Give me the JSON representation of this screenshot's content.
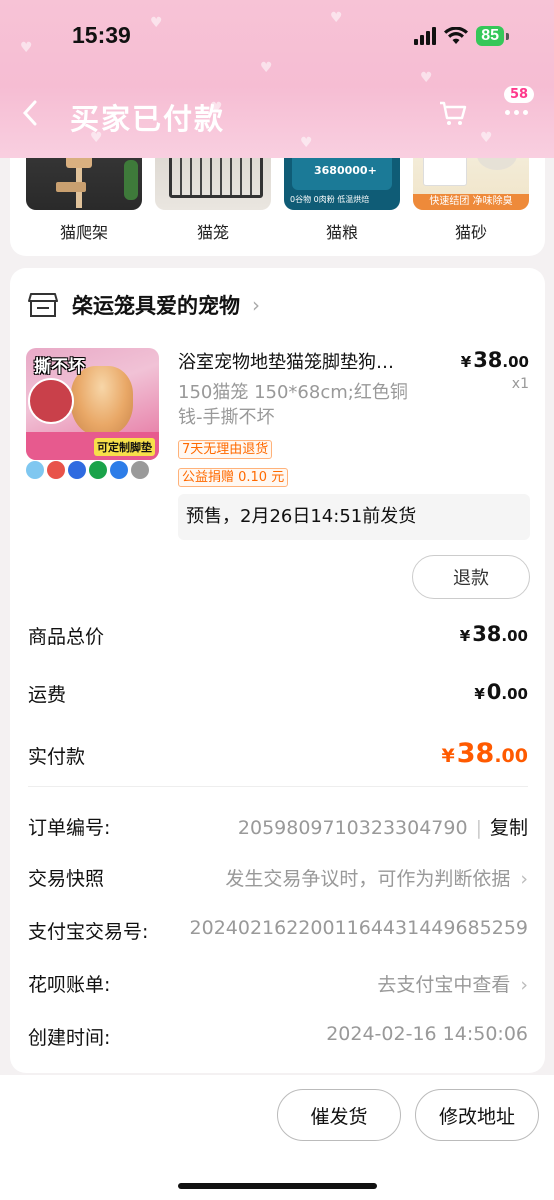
{
  "status_bar": {
    "time": "15:39",
    "battery": "85"
  },
  "nav": {
    "title": "买家已付款",
    "more_badge": "58",
    "back_icon": "back-arrow-icon",
    "cart_icon": "cart-icon",
    "more_icon": "more-dots-icon"
  },
  "categories": [
    {
      "label": "猫爬架",
      "image": "cat-tree-image"
    },
    {
      "label": "猫笼",
      "image": "cat-cage-image"
    },
    {
      "label": "猫粮",
      "image": "cat-food-image",
      "img_lines": [
        "3680000+",
        "0谷物  0肉粉  低温烘焙"
      ]
    },
    {
      "label": "猫砂",
      "image": "cat-litter-image",
      "img_lines": [
        "快速结团  净味除臭"
      ]
    }
  ],
  "shop": {
    "name": "棨运笼具爱的宠物",
    "icon": "store-icon"
  },
  "product": {
    "title": "浴室宠物地垫猫笼脚垫狗…",
    "spec": "150猫笼 150*68cm;红色铜钱-手撕不坏",
    "price_int": "38",
    "price_dec": ".00",
    "currency": "¥",
    "qty": "x1",
    "image_top_text": "撕不坏",
    "image_bottom_text": "可定制脚垫",
    "badge1": "7天无理由退货",
    "badge2": "公益捐赠 0.10 元",
    "presale": "预售，2月26日14:51前发货",
    "refund_label": "退款",
    "swatch_colors": [
      "#7fc7f0",
      "#e8534a",
      "#2f6be0",
      "#1aa34a",
      "#2d7de8",
      "#9a9a9a"
    ]
  },
  "summary": {
    "goods_label": "商品总价",
    "goods_int": "38",
    "goods_dec": ".00",
    "shipping_label": "运费",
    "shipping_int": "0",
    "shipping_dec": ".00",
    "paid_label": "实付款",
    "paid_int": "38",
    "paid_dec": ".00",
    "paid_color": "#ff5a00"
  },
  "info": {
    "order_no_label": "订单编号:",
    "order_no": "2059809710323304790",
    "copy_label": "复制",
    "snapshot_label": "交易快照",
    "snapshot_value": "发生交易争议时，可作为判断依据",
    "alipay_label": "支付宝交易号:",
    "alipay_value": "2024021622001164431449685259",
    "huabei_label": "花呗账单:",
    "huabei_value": "去支付宝中查看",
    "created_label": "创建时间:",
    "created_value": "2024-02-16 14:50:06"
  },
  "actions": {
    "urge_label": "催发货",
    "address_label": "修改地址"
  }
}
